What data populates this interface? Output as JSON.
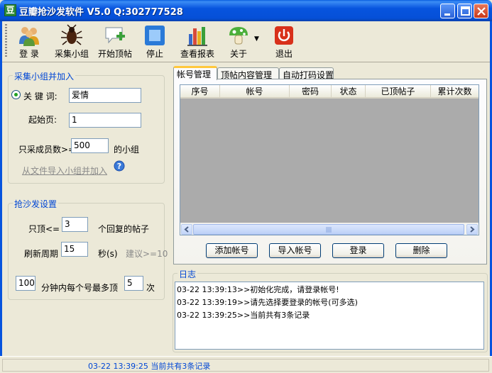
{
  "window": {
    "title": "豆瓣抢沙发软件 V5.0 Q:302777528",
    "icon_char": "豆"
  },
  "toolbar": {
    "items": [
      {
        "label": "登 录",
        "icon": "users-icon"
      },
      {
        "label": "采集小组",
        "icon": "bug-icon"
      },
      {
        "label": "开始顶帖",
        "icon": "add-post-icon"
      },
      {
        "label": "停止",
        "icon": "stop-icon"
      },
      {
        "label": "查看报表",
        "icon": "report-icon"
      },
      {
        "label": "关于",
        "icon": "mushroom-icon"
      },
      {
        "label": "退出",
        "icon": "power-icon"
      }
    ]
  },
  "collect_group": {
    "title": "采集小组并加入",
    "keyword_label": "关 键 词:",
    "keyword_value": "爱情",
    "start_page_label": "起始页:",
    "start_page_value": "1",
    "members_label": "只采成员数>=",
    "members_value": "500",
    "members_suffix": "的小组",
    "import_link": "从文件导入小组并加入"
  },
  "sofa_settings": {
    "title": "抢沙发设置",
    "top_only_label": "只顶<=",
    "top_only_value": "3",
    "top_only_suffix": "个回复的帖子",
    "refresh_label": "刷新周期",
    "refresh_value": "15",
    "refresh_unit": "秒(s)",
    "refresh_hint": "建议>=10",
    "minutes_value": "100",
    "per_account_label": "分钟内每个号最多顶",
    "max_value": "5",
    "times_label": "次"
  },
  "tabs": [
    {
      "label": "帐号管理",
      "active": true
    },
    {
      "label": "顶帖内容管理",
      "active": false
    },
    {
      "label": "自动打码设置",
      "active": false
    }
  ],
  "account_table": {
    "columns": [
      "序号",
      "帐号",
      "密码",
      "状态",
      "已顶帖子",
      "累计次数"
    ],
    "rows": []
  },
  "account_buttons": {
    "add": "添加帐号",
    "import": "导入帐号",
    "login": "登录",
    "delete": "删除"
  },
  "log": {
    "title": "日志",
    "lines": [
      "03-22 13:39:13>>初始化完成，请登录帐号!",
      "03-22 13:39:19>>请先选择要登录的帐号(可多选)",
      "03-22 13:39:25>>当前共有3条记录"
    ]
  },
  "status": {
    "text": "03-22 13:39:25 当前共有3条记录"
  },
  "colors": {
    "title_bar": "#0754DE",
    "group_title": "#0046D5",
    "list_bg": "#ABABAB"
  }
}
